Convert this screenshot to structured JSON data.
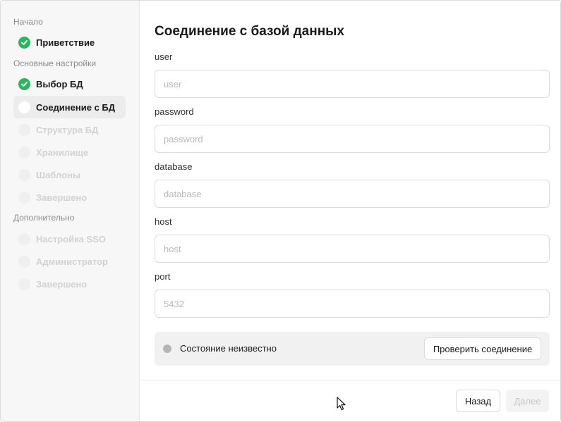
{
  "sidebar": {
    "sections": [
      {
        "label": "Начало"
      },
      {
        "label": "Основные настройки"
      },
      {
        "label": "Дополнительно"
      }
    ],
    "items": [
      {
        "label": "Приветствие",
        "state": "done"
      },
      {
        "label": "Выбор БД",
        "state": "done"
      },
      {
        "label": "Соединение с БД",
        "state": "current"
      },
      {
        "label": "Структура БД",
        "state": "pending"
      },
      {
        "label": "Хранилище",
        "state": "pending"
      },
      {
        "label": "Шаблоны",
        "state": "pending"
      },
      {
        "label": "Завершено",
        "state": "pending"
      },
      {
        "label": "Настройка SSO",
        "state": "pending"
      },
      {
        "label": "Администратор",
        "state": "pending"
      },
      {
        "label": "Завершено",
        "state": "pending"
      }
    ]
  },
  "main": {
    "title": "Соединение с базой данных",
    "fields": [
      {
        "label": "user",
        "placeholder": "user",
        "value": ""
      },
      {
        "label": "password",
        "placeholder": "password",
        "value": ""
      },
      {
        "label": "database",
        "placeholder": "database",
        "value": ""
      },
      {
        "label": "host",
        "placeholder": "host",
        "value": ""
      },
      {
        "label": "port",
        "placeholder": "5432",
        "value": ""
      }
    ],
    "status": {
      "text": "Состояние неизвестно",
      "check_button": "Проверить соединение"
    }
  },
  "footer": {
    "back_label": "Назад",
    "next_label": "Далее"
  },
  "colors": {
    "done": "#2db55d",
    "status_unknown": "#b5b5b5"
  },
  "icons": {
    "done": "check-icon",
    "status": "status-dot-icon"
  }
}
